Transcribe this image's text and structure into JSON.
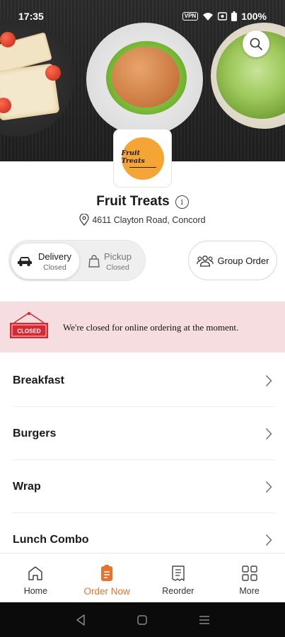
{
  "status_bar": {
    "time": "17:35",
    "vpn": "VPN",
    "battery": "100%"
  },
  "store": {
    "name": "Fruit Treats",
    "address": "4611 Clayton Road, Concord",
    "logo_text": "Fruit Treats"
  },
  "order_modes": {
    "delivery": {
      "label": "Delivery",
      "status": "Closed",
      "selected": true
    },
    "pickup": {
      "label": "Pickup",
      "status": "Closed",
      "selected": false
    }
  },
  "group_order_label": "Group Order",
  "closed_banner": {
    "sign_text": "CLOSED",
    "message": "We're closed for online ordering at the moment."
  },
  "categories": [
    "Breakfast",
    "Burgers",
    "Wrap",
    "Lunch Combo"
  ],
  "bottom_nav": {
    "items": [
      {
        "label": "Home",
        "icon": "home-icon",
        "active": false
      },
      {
        "label": "Order Now",
        "icon": "order-icon",
        "active": true
      },
      {
        "label": "Reorder",
        "icon": "receipt-icon",
        "active": false
      },
      {
        "label": "More",
        "icon": "grid-icon",
        "active": false
      }
    ]
  },
  "colors": {
    "accent": "#e8722a",
    "banner_bg": "#f6dde0",
    "logo": "#f5a436",
    "sign_red": "#d42a34"
  }
}
